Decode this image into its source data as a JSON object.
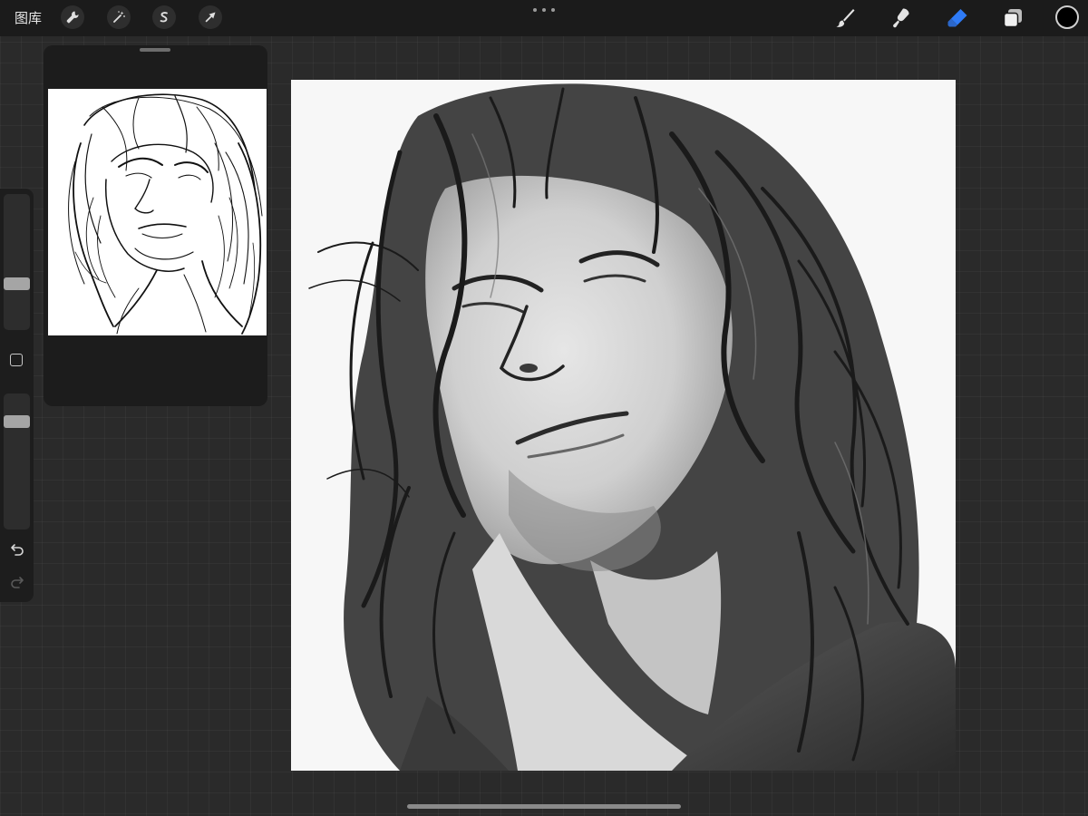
{
  "topbar": {
    "gallery_label": "图库",
    "left_tools": [
      {
        "icon": "wrench-icon",
        "name": "actions"
      },
      {
        "icon": "magic-wand-icon",
        "name": "adjustments"
      },
      {
        "icon": "selection-s-icon",
        "name": "selection"
      },
      {
        "icon": "arrow-cursor-icon",
        "name": "transform"
      }
    ],
    "right_tools": [
      {
        "icon": "brush-icon",
        "name": "brush"
      },
      {
        "icon": "smudge-icon",
        "name": "smudge"
      },
      {
        "icon": "eraser-icon",
        "name": "eraser",
        "active": true
      },
      {
        "icon": "layers-icon",
        "name": "layers"
      }
    ],
    "current_color": "#000000",
    "active_tool_color": "#2f7bf6"
  },
  "sidebar": {
    "brush_size_level": 0.68,
    "opacity_level": 0.18
  }
}
